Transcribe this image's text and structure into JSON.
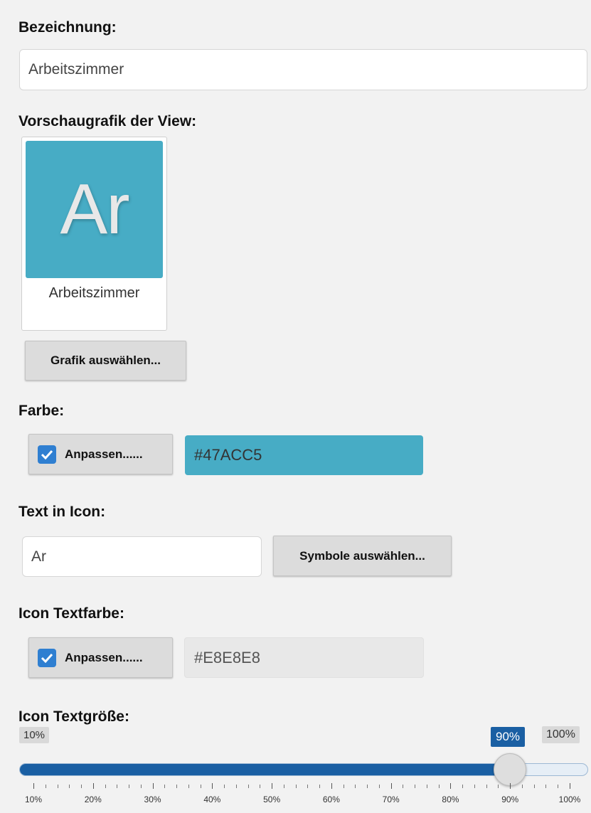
{
  "bezeichnung": {
    "label": "Bezeichnung:",
    "value": "Arbeitszimmer"
  },
  "preview": {
    "label": "Vorschaugrafik der View:",
    "icon_text": "Ar",
    "caption": "Arbeitszimmer",
    "bg_color": "#47ACC5",
    "text_color": "#E8E8E8"
  },
  "select_graphic_button": "Grafik auswählen...",
  "farbe": {
    "label": "Farbe:",
    "customize_label": "Anpassen......",
    "checked": true,
    "value": "#47ACC5"
  },
  "icon_text": {
    "label": "Text in Icon:",
    "value": "Ar",
    "symbols_button": "Symbole auswählen..."
  },
  "icon_textcolor": {
    "label": "Icon Textfarbe:",
    "customize_label": "Anpassen......",
    "checked": true,
    "value": "#E8E8E8"
  },
  "icon_textsize": {
    "label": "Icon Textgröße:",
    "min_label": "10%",
    "max_label": "100%",
    "current_label": "90%",
    "value_percent": 90,
    "min": 10,
    "max": 100,
    "scale_labels": [
      "10%",
      "20%",
      "30%",
      "40%",
      "50%",
      "60%",
      "70%",
      "80%",
      "90%",
      "100%"
    ],
    "track_color": "#1a5fa3"
  }
}
